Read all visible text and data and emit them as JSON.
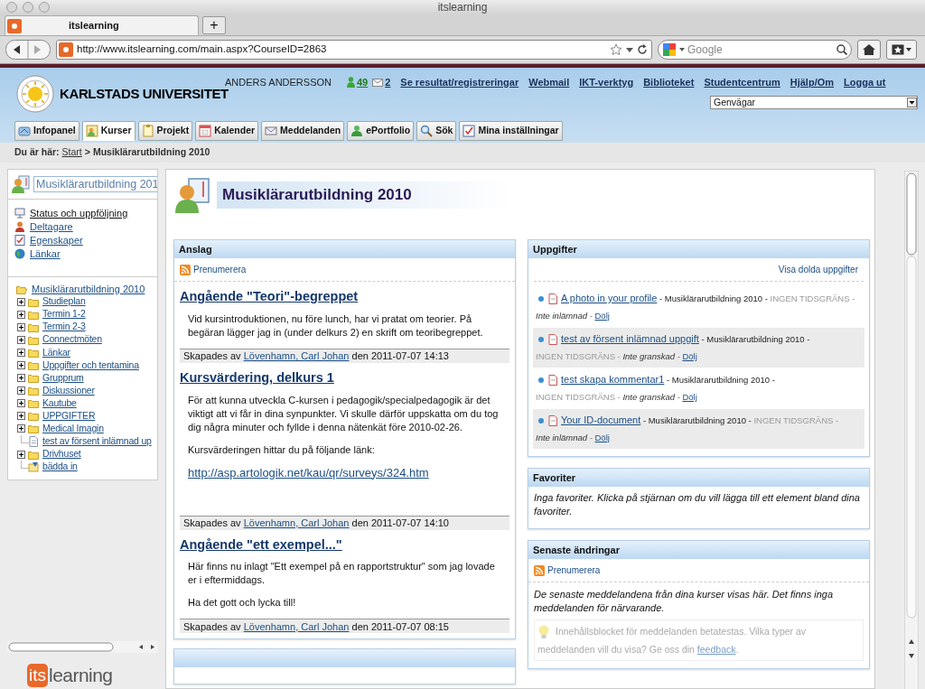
{
  "window": {
    "title": "itslearning"
  },
  "browser_tabs": [
    {
      "label": "itslearning",
      "selected": true
    }
  ],
  "new_tab_button": "+",
  "address": "http://www.itslearning.com/main.aspx?CourseID=2863",
  "search": {
    "placeholder": "Google"
  },
  "header": {
    "university": "KARLSTADS UNIVERSITET",
    "user": "ANDERS ANDERSSON",
    "contacts_count": "49",
    "messages_count": "2",
    "links": [
      "Se resultat/registreringar",
      "Webmail",
      "IKT-verktyg",
      "Biblioteket",
      "Studentcentrum",
      "Hjälp/Om",
      "Logga ut"
    ],
    "shortcut_select": "Genvägar"
  },
  "nav_tabs": [
    {
      "label": "Infopanel",
      "selected": false
    },
    {
      "label": "Kurser",
      "selected": true
    },
    {
      "label": "Projekt",
      "selected": false
    },
    {
      "label": "Kalender",
      "selected": false
    },
    {
      "label": "Meddelanden",
      "selected": false
    },
    {
      "label": "ePortfolio",
      "selected": false
    },
    {
      "label": "Sök",
      "selected": false
    },
    {
      "label": "Mina inställningar",
      "selected": false
    }
  ],
  "breadcrumb": {
    "label": "Du är här:",
    "start": "Start",
    "separator": ">",
    "current": "Musiklärarutbildning 2010"
  },
  "sidebar": {
    "course_field": "Musiklärarutbildning 201",
    "links": [
      {
        "label": "Status och uppföljning",
        "kind": "status"
      },
      {
        "label": "Deltagare",
        "kind": "people"
      },
      {
        "label": "Egenskaper",
        "kind": "properties"
      },
      {
        "label": "Länkar",
        "kind": "links"
      }
    ],
    "tree": {
      "label": "Musiklärarutbildning 2010",
      "expanded": true,
      "children": [
        {
          "label": "Studieplan",
          "kind": "folder",
          "expanded": false
        },
        {
          "label": "Termin 1-2",
          "kind": "folder",
          "expanded": false
        },
        {
          "label": "Termin 2-3",
          "kind": "folder",
          "expanded": false
        },
        {
          "label": "Connectmöten",
          "kind": "folder",
          "expanded": false
        },
        {
          "label": "Länkar",
          "kind": "folder",
          "expanded": false
        },
        {
          "label": "Uppgifter och tentamina",
          "kind": "folder",
          "expanded": false
        },
        {
          "label": "Grupprum",
          "kind": "folder",
          "expanded": false
        },
        {
          "label": "Diskussioner",
          "kind": "folder",
          "expanded": false
        },
        {
          "label": "Kautube",
          "kind": "folder",
          "expanded": false
        },
        {
          "label": "UPPGIFTER",
          "kind": "folder",
          "expanded": false
        },
        {
          "label": "Medical Imagin",
          "kind": "folder",
          "expanded": false
        },
        {
          "label": "test av försent inlämnad up",
          "kind": "document"
        },
        {
          "label": "Drivhuset",
          "kind": "folder",
          "expanded": false
        },
        {
          "label": "bädda in",
          "kind": "embed"
        }
      ]
    }
  },
  "page": {
    "title": "Musiklärarutbildning 2010"
  },
  "announcements": {
    "title": "Anslag",
    "subscribe": "Prenumerera",
    "posts": [
      {
        "title": "Angående \"Teori\"-begreppet",
        "body": [
          {
            "kind": "text",
            "text": "Vid kursintroduktionen, nu före lunch, har vi pratat om teorier. På begäran lägger jag in (under delkurs 2) en skrift om teoribegreppet."
          }
        ],
        "footer": {
          "prefix": "Skapades av",
          "author": "Lövenhamn, Carl Johan",
          "suffix": "den 2011-07-07 14:13"
        }
      },
      {
        "title": "Kursvärdering, delkurs 1",
        "body": [
          {
            "kind": "text",
            "text": "För att kunna utveckla C-kursen i pedagogik/specialpedagogik är det viktigt att vi får in dina synpunkter. Vi skulle därför uppskatta om du tog dig några minuter och fyllde i denna nätenkät före 2010-02-26."
          },
          {
            "kind": "text",
            "text": "Kursvärderingen hittar du på följande länk:"
          },
          {
            "kind": "link",
            "text": "http://asp.artologik.net/kau/qr/surveys/324.htm"
          }
        ],
        "footer": {
          "prefix": "Skapades av",
          "author": "Lövenhamn, Carl Johan",
          "suffix": "den 2011-07-07 14:10"
        }
      },
      {
        "title": "Angående \"ett exempel...\"",
        "body": [
          {
            "kind": "text",
            "text": "Här finns nu inlagt \"Ett exempel på en rapportstruktur\" som jag lovade er i eftermiddags."
          },
          {
            "kind": "text",
            "text": "Ha det gott och lycka till!"
          }
        ],
        "footer": {
          "prefix": "Skapades av",
          "author": "Lövenhamn, Carl Johan",
          "suffix": "den 2011-07-07 08:15"
        }
      }
    ]
  },
  "tasks": {
    "title": "Uppgifter",
    "show_hidden": "Visa dolda uppgifter",
    "items": [
      {
        "title": "A photo in your profile",
        "course": "- Musiklärarutbildning 2010 -",
        "deadline": "INGEN TIDSGRÄNS -",
        "status": "Inte inlämnad -",
        "hide": "Dölj"
      },
      {
        "title": "test av försent inlämnad uppgift",
        "course": "- Musiklärarutbildning 2010 -",
        "deadline": "INGEN TIDSGRÄNS -",
        "status": "Inte granskad -",
        "hide": "Dölj"
      },
      {
        "title": "test skapa kommentar1",
        "course": "- Musiklärarutbildning 2010 -",
        "deadline": "INGEN TIDSGRÄNS -",
        "status": "Inte granskad -",
        "hide": "Dölj"
      },
      {
        "title": "Your ID-document",
        "course": "- Musiklärarutbildning 2010 -",
        "deadline": "INGEN TIDSGRÄNS -",
        "status": "Inte inlämnad -",
        "hide": "Dölj"
      }
    ]
  },
  "favorites": {
    "title": "Favoriter",
    "text": "Inga favoriter. Klicka på stjärnan om du vill lägga till ett element bland dina favoriter."
  },
  "recent_changes": {
    "title": "Senaste ändringar",
    "subscribe": "Prenumerera",
    "text": "De senaste meddelandena från dina kurser visas här. Det finns inga meddelanden för närvarande.",
    "tip": {
      "text": "Innehållsblocket för meddelanden betatestas. Vilka typer av meddelanden vill du visa? Ge oss din",
      "link": "feedback",
      "after": "."
    }
  },
  "logo": {
    "mark": "its",
    "word": "learning"
  }
}
